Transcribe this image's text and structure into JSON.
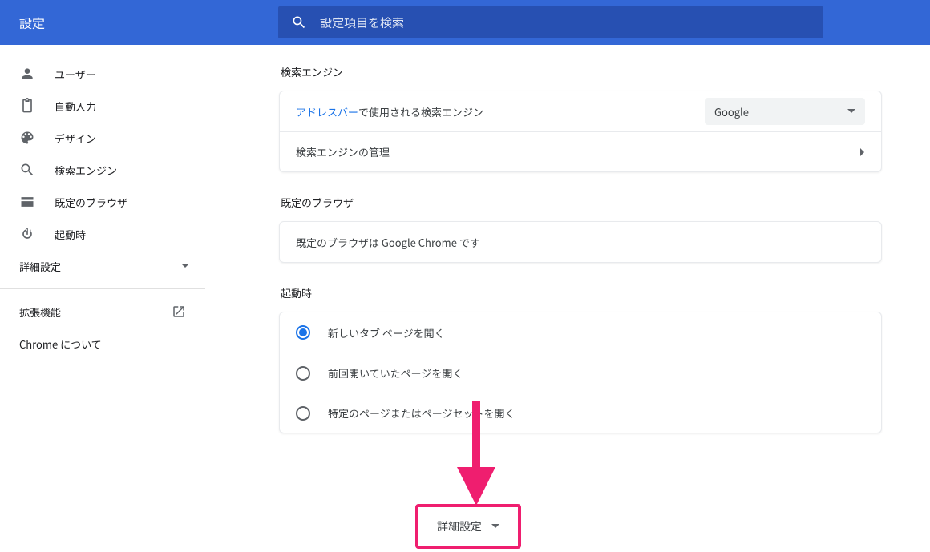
{
  "header": {
    "title": "設定",
    "search_placeholder": "設定項目を検索"
  },
  "sidebar": {
    "items": [
      {
        "label": "ユーザー"
      },
      {
        "label": "自動入力"
      },
      {
        "label": "デザイン"
      },
      {
        "label": "検索エンジン"
      },
      {
        "label": "既定のブラウザ"
      },
      {
        "label": "起動時"
      }
    ],
    "advanced": "詳細設定",
    "extensions": "拡張機能",
    "about": "Chrome について"
  },
  "sections": {
    "search_engine": {
      "heading": "検索エンジン",
      "row1_link": "アドレスバー",
      "row1_rest": "で使用される検索エンジン",
      "engine_value": "Google",
      "row2": "検索エンジンの管理"
    },
    "default_browser": {
      "heading": "既定のブラウザ",
      "text": "既定のブラウザは Google Chrome です"
    },
    "startup": {
      "heading": "起動時",
      "options": [
        "新しいタブ ページを開く",
        "前回開いていたページを開く",
        "特定のページまたはページセットを開く"
      ]
    }
  },
  "advanced_button": "詳細設定"
}
